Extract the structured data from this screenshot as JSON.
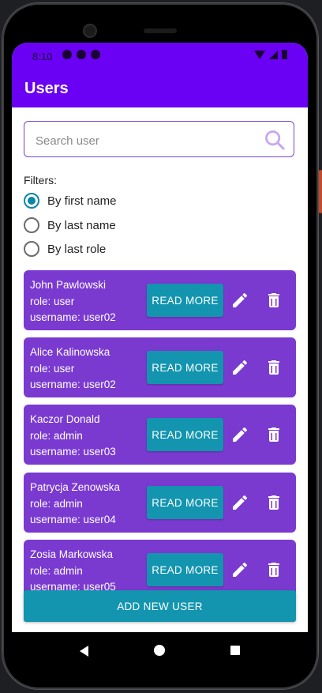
{
  "status_bar": {
    "time": "8:10"
  },
  "app_bar": {
    "title": "Users"
  },
  "search": {
    "placeholder": "Search user",
    "value": ""
  },
  "filters": {
    "label": "Filters:",
    "options": [
      {
        "label": "By first name",
        "checked": true
      },
      {
        "label": "By last name",
        "checked": false
      },
      {
        "label": "By last role",
        "checked": false
      }
    ]
  },
  "users": [
    {
      "name": "John Pawlowski",
      "role": "role: user",
      "username": "username: user02"
    },
    {
      "name": "Alice Kalinowska",
      "role": "role: user",
      "username": "username: user02"
    },
    {
      "name": "Kaczor Donald",
      "role": "role: admin",
      "username": "username: user03"
    },
    {
      "name": "Patrycja Zenowska",
      "role": "role: admin",
      "username": "username: user04"
    },
    {
      "name": "Zosia Markowska",
      "role": "role: admin",
      "username": "username: user05"
    }
  ],
  "card_actions": {
    "read_more_label": "READ MORE"
  },
  "footer": {
    "add_user_label": "ADD NEW USER"
  },
  "colors": {
    "primary": "#6a00f4",
    "card": "#7a3ad0",
    "accent": "#1395b0",
    "radio_checked": "#0a87a8"
  },
  "icons": {
    "search": "search-icon",
    "edit": "pencil-icon",
    "delete": "trash-icon",
    "nav_back": "back-triangle-icon",
    "nav_home": "home-circle-icon",
    "nav_recents": "recents-square-icon"
  }
}
